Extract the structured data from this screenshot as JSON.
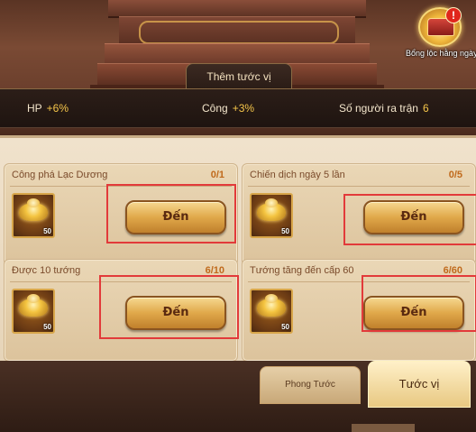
{
  "daily_gift": {
    "label": "Bổng lộc hằng ngày",
    "badge": "!"
  },
  "bonus": {
    "tab_label": "Thêm tước vị",
    "stats": [
      {
        "label": "HP",
        "value": "+6%"
      },
      {
        "label": "Công",
        "value": "+3%"
      },
      {
        "label": "Số người ra trận",
        "value": "6"
      }
    ]
  },
  "tasks": [
    {
      "title": "Công phá Lạc Dương",
      "progress": "0/1",
      "reward_qty": "50",
      "button": "Đến"
    },
    {
      "title": "Chiến dịch ngày 5 lần",
      "progress": "0/5",
      "reward_qty": "50",
      "button": "Đến"
    },
    {
      "title": "Được 10 tướng",
      "progress": "6/10",
      "reward_qty": "50",
      "button": "Đến"
    },
    {
      "title": "Tướng tăng đến cấp 60",
      "progress": "6/60",
      "reward_qty": "50",
      "button": "Đến"
    }
  ],
  "bottom_tabs": [
    {
      "label": "Phong Tước",
      "active": false
    },
    {
      "label": "Tước vị",
      "active": true
    }
  ],
  "colors": {
    "accent_gold": "#f6c64a",
    "highlight": "#e23a3a",
    "progress": "#c06a1c"
  }
}
